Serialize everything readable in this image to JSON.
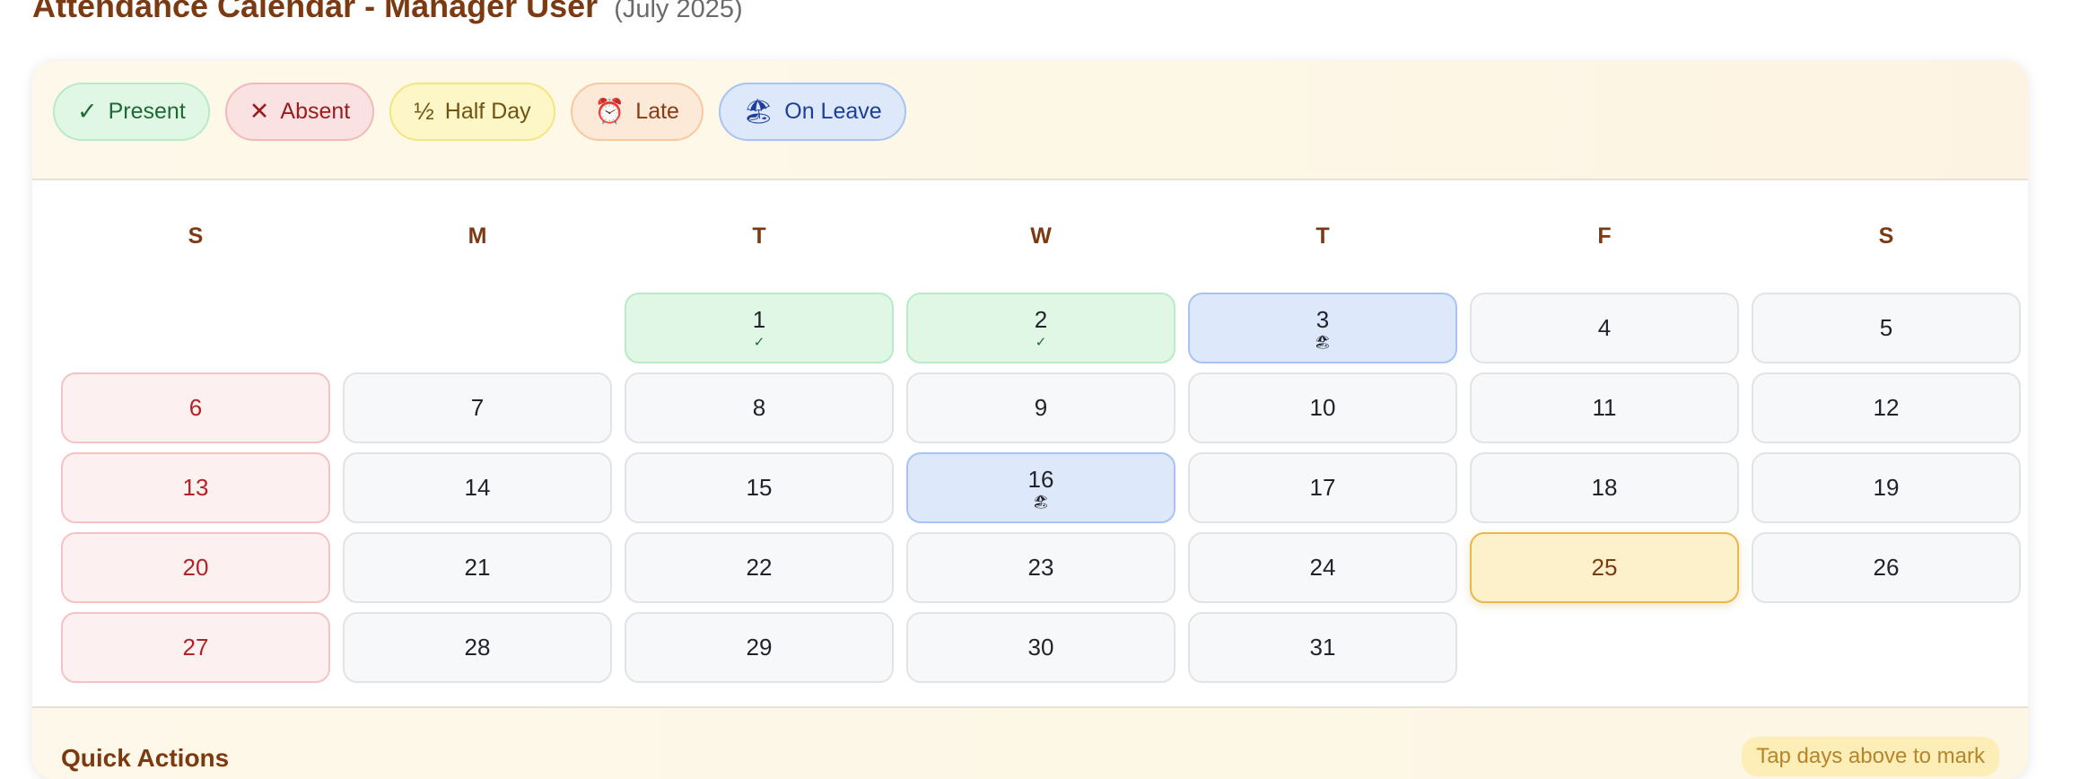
{
  "header": {
    "title": "Attendance Calendar - Manager User",
    "period": "(July 2025)"
  },
  "legend": [
    {
      "key": "present",
      "icon": "check-icon",
      "glyph": "✓",
      "label": "Present",
      "color": "#1f6a34"
    },
    {
      "key": "absent",
      "icon": "close-icon",
      "glyph": "✕",
      "label": "Absent",
      "color": "#9b1c1c"
    },
    {
      "key": "half",
      "icon": "half-icon",
      "glyph": "½",
      "label": "Half Day",
      "color": "#6f5314"
    },
    {
      "key": "late",
      "icon": "alarm-clock-icon",
      "glyph": "⏰",
      "label": "Late",
      "color": "#8a3b12"
    },
    {
      "key": "leave",
      "icon": "beach-umbrella-icon",
      "glyph": "🏖",
      "label": "On Leave",
      "color": "#1d3f99"
    }
  ],
  "weekdays": [
    "S",
    "M",
    "T",
    "W",
    "T",
    "F",
    "S"
  ],
  "calendar": {
    "first_weekday_index": 2,
    "today": 25,
    "days": [
      {
        "n": "1",
        "status": "present",
        "mark": "✓"
      },
      {
        "n": "2",
        "status": "present",
        "mark": "✓"
      },
      {
        "n": "3",
        "status": "leave",
        "mark": "🏖"
      },
      {
        "n": "4"
      },
      {
        "n": "5"
      },
      {
        "n": "6"
      },
      {
        "n": "7"
      },
      {
        "n": "8"
      },
      {
        "n": "9"
      },
      {
        "n": "10"
      },
      {
        "n": "11"
      },
      {
        "n": "12"
      },
      {
        "n": "13"
      },
      {
        "n": "14"
      },
      {
        "n": "15"
      },
      {
        "n": "16",
        "status": "leave",
        "mark": "🏖"
      },
      {
        "n": "17"
      },
      {
        "n": "18"
      },
      {
        "n": "19"
      },
      {
        "n": "20"
      },
      {
        "n": "21"
      },
      {
        "n": "22"
      },
      {
        "n": "23"
      },
      {
        "n": "24"
      },
      {
        "n": "25"
      },
      {
        "n": "26"
      },
      {
        "n": "27"
      },
      {
        "n": "28"
      },
      {
        "n": "29"
      },
      {
        "n": "30"
      },
      {
        "n": "31"
      }
    ]
  },
  "quick_actions": {
    "title": "Quick Actions",
    "hint": "Tap days above to mark"
  }
}
